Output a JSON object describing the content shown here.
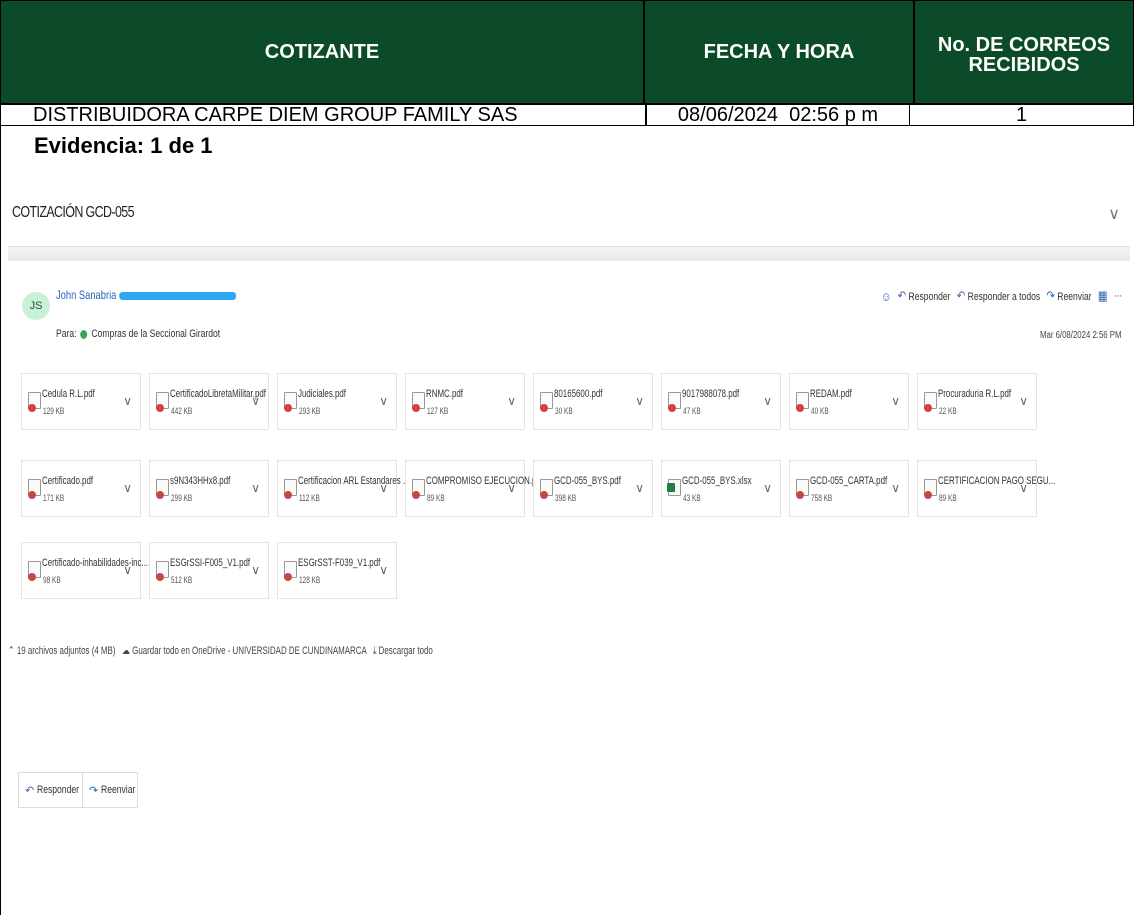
{
  "table": {
    "headers": [
      "COTIZANTE",
      "FECHA Y HORA",
      "No. DE CORREOS RECIBIDOS"
    ],
    "row": {
      "cotizante": "DISTRIBUIDORA CARPE DIEM GROUP FAMILY SAS",
      "fecha_hora": "08/06/2024  02:56 p m",
      "correos": "1"
    },
    "header_color": "#0b4b2a"
  },
  "evidence_label": "Evidencia: 1 de 1",
  "email": {
    "subject": "COTIZACIÓN GCD-055",
    "sender_initials": "JS",
    "sender_name": "John Sanabria",
    "to_prefix": "Para:",
    "to_recipient": "Compras de la Seccional Girardot",
    "actions": {
      "reply": "Responder",
      "reply_all": "Responder a todos",
      "forward": "Reenviar"
    },
    "timestamp": "Mar 6/08/2024 2:56 PM",
    "attachments": [
      {
        "name": "Cedula R.L.pdf",
        "size": "129 KB",
        "type": "pdf"
      },
      {
        "name": "CertificadoLibretaMilitar.pdf",
        "size": "442 KB",
        "type": "pdf"
      },
      {
        "name": "Judiciales.pdf",
        "size": "293 KB",
        "type": "pdf"
      },
      {
        "name": "RNMC.pdf",
        "size": "127 KB",
        "type": "pdf"
      },
      {
        "name": "80165600.pdf",
        "size": "30 KB",
        "type": "pdf"
      },
      {
        "name": "9017988078.pdf",
        "size": "47 KB",
        "type": "pdf"
      },
      {
        "name": "REDAM.pdf",
        "size": "40 KB",
        "type": "pdf"
      },
      {
        "name": "Procuraduria R.L.pdf",
        "size": "22 KB",
        "type": "pdf"
      },
      {
        "name": "Certificado.pdf",
        "size": "171 KB",
        "type": "pdf"
      },
      {
        "name": "s9N343HHx8.pdf",
        "size": "299 KB",
        "type": "pdf"
      },
      {
        "name": "Certificacion ARL Estandares ...",
        "size": "112 KB",
        "type": "pdf"
      },
      {
        "name": "COMPROMISO EJECUCION.pdf",
        "size": "89 KB",
        "type": "pdf"
      },
      {
        "name": "GCD-055_BYS.pdf",
        "size": "398 KB",
        "type": "pdf"
      },
      {
        "name": "GCD-055_BYS.xlsx",
        "size": "43 KB",
        "type": "xlsx"
      },
      {
        "name": "GCD-055_CARTA.pdf",
        "size": "758 KB",
        "type": "pdf"
      },
      {
        "name": "CERTIFICACION PAGO SEGU...",
        "size": "89 KB",
        "type": "pdf"
      },
      {
        "name": "Certificado-inhabilidades-inc...",
        "size": "98 KB",
        "type": "pdf"
      },
      {
        "name": "ESGrSSI-F005_V1.pdf",
        "size": "512 KB",
        "type": "pdf"
      },
      {
        "name": "ESGrSST-F039_V1.pdf",
        "size": "128 KB",
        "type": "pdf"
      }
    ],
    "attachments_summary": "19 archivos adjuntos (4 MB)",
    "save_all": "Guardar todo en OneDrive - UNIVERSIDAD DE CUNDINAMARCA",
    "download_all": "Descargar todo",
    "bottom_buttons": {
      "reply": "Responder",
      "forward": "Reenviar"
    }
  }
}
